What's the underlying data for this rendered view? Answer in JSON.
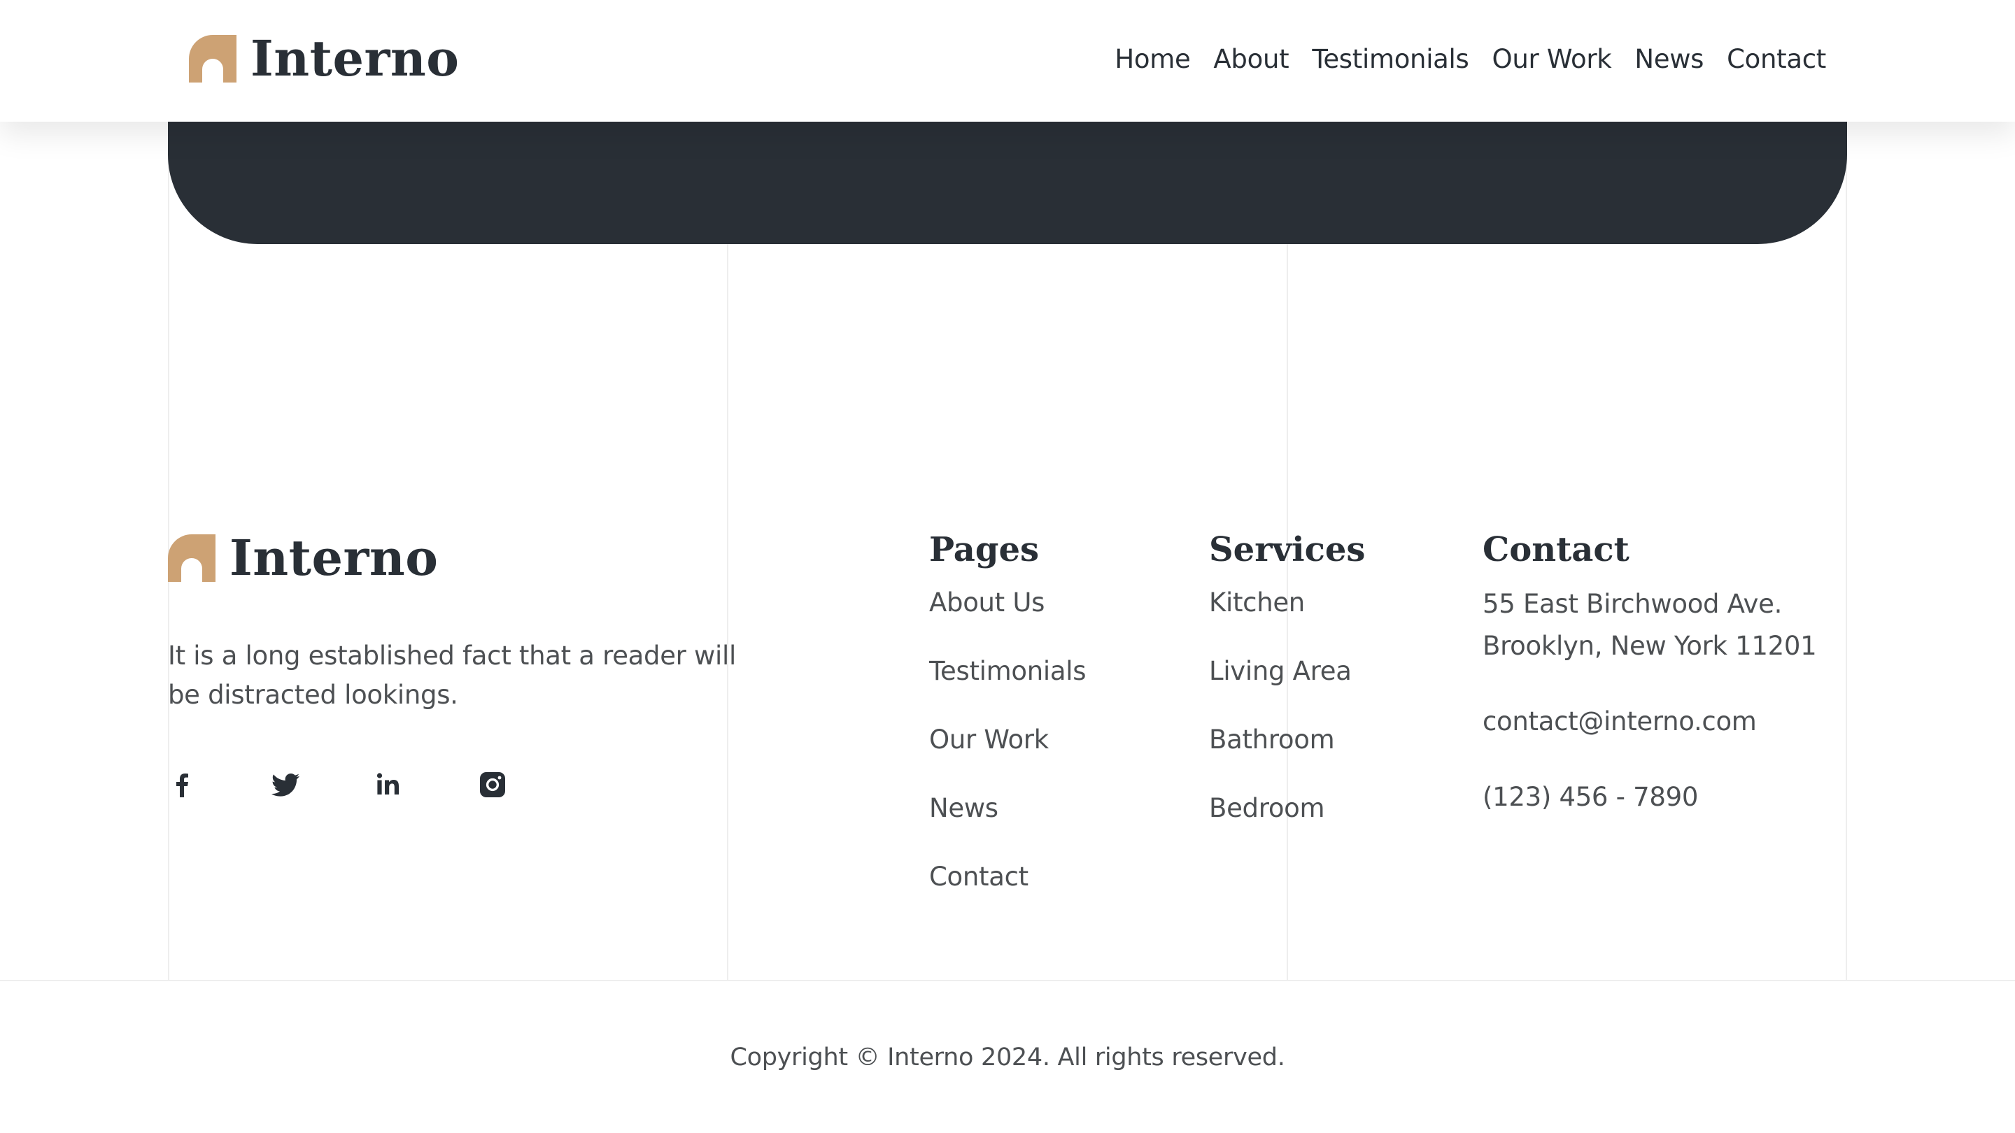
{
  "brand": {
    "name": "Interno",
    "accent_color": "#cda274",
    "dark_color": "#292f36"
  },
  "header": {
    "logo_text": "Interno",
    "nav": [
      "Home",
      "About",
      "Testimonials",
      "Our Work",
      "News",
      "Contact"
    ]
  },
  "footer": {
    "logo_text": "Interno",
    "description": "It is a long established fact that a reader will be distracted lookings.",
    "social": [
      {
        "name": "facebook-icon"
      },
      {
        "name": "twitter-icon"
      },
      {
        "name": "linkedin-icon"
      },
      {
        "name": "instagram-icon"
      }
    ],
    "pages": {
      "title": "Pages",
      "links": [
        "About Us",
        "Testimonials",
        "Our Work",
        "News",
        "Contact"
      ]
    },
    "services": {
      "title": "Services",
      "links": [
        "Kitchen",
        "Living Area",
        "Bathroom",
        "Bedroom"
      ]
    },
    "contact": {
      "title": "Contact",
      "address_line1": "55 East Birchwood Ave.",
      "address_line2": "Brooklyn, New York 11201",
      "email": "contact@interno.com",
      "phone": "(123) 456 - 7890"
    }
  },
  "copyright": "Copyright © Interno 2024. All rights reserved."
}
